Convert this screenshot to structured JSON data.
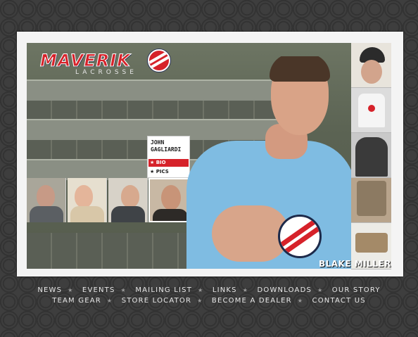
{
  "logo": {
    "brand": "MAVERIK",
    "sub": "LACROSSE"
  },
  "bio_card": {
    "name_line1": "JOHN",
    "name_line2": "GAGLIARDI",
    "bio_label": "BIO",
    "pics_label": "PICS",
    "star": "★"
  },
  "hero": {
    "caption": "BLAKE MILLER"
  },
  "nav": {
    "row1": [
      "NEWS",
      "EVENTS",
      "MAILING LIST",
      "LINKS",
      "DOWNLOADS",
      "OUR STORY"
    ],
    "row2": [
      "TEAM GEAR",
      "STORE LOCATOR",
      "BECOME A DEALER",
      "CONTACT US"
    ],
    "separator": "★"
  },
  "colors": {
    "brand_red": "#d6222a",
    "brand_navy": "#1d2a4a",
    "shirt_blue": "#7fbce2",
    "background": "#3e3e3e"
  }
}
